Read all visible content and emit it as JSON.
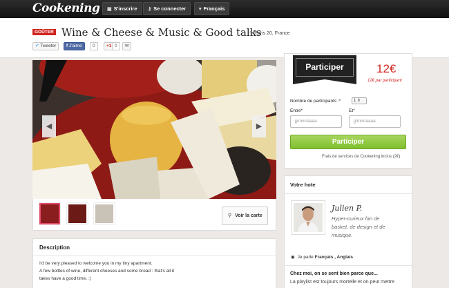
{
  "nav": {
    "logo": "Cookening",
    "signup": "S'inscrire",
    "login": "Se connecter",
    "language": "Français"
  },
  "event": {
    "badge": "GOÛTER",
    "title": "Wine & Cheese & Music & Good talks",
    "location": "Paris 20, France"
  },
  "share": {
    "tweet": "Tweeter",
    "like": "J'aime",
    "like_count": "0",
    "gplus": "+1",
    "gplus_count": "0"
  },
  "gallery": {
    "map_button": "Voir la carte"
  },
  "booking": {
    "participate_ribbon": "Participer",
    "price": "12€",
    "price_per": "12€ par participant",
    "participants_label": "Nombre de participants :*",
    "participants_value": "1",
    "enter_label": "Entre*",
    "and_label": "Et*",
    "enter_placeholder": "jj/mm/aaaa",
    "and_placeholder": "jj/mm/aaaa",
    "participate_button": "Participer",
    "fees": "Frais de services de Cookening inclus (2€)"
  },
  "host": {
    "section_title": "Votre hote",
    "name": "Julien P.",
    "bio_line1": "Hyper-curieux fan de",
    "bio_line2": "basket, de design et de",
    "bio_line3": "musique.",
    "speaks_prefix": "Je parle",
    "languages": "Français , Anglais",
    "chez_moi": "Chez moi, on se sent bien parce que...",
    "playlist": "La playlist est toujours mortelle et on peut mettre"
  },
  "description": {
    "title": "Description",
    "line1": "I'd be very pleased to welcome you in my tiny apartment.",
    "line2": "A few bottles of wine, different cheeses and some bread : that's all it",
    "line3": "takes have a good time. :)"
  }
}
